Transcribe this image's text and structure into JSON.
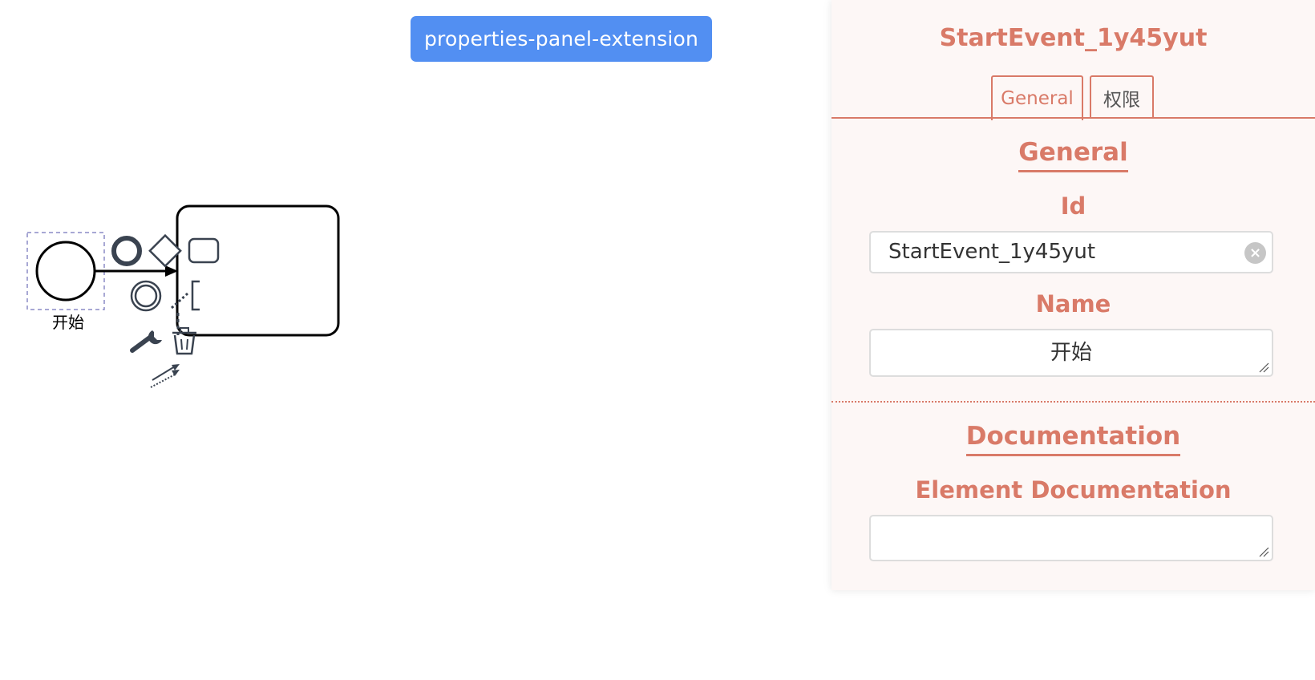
{
  "toolbar": {
    "button_label": "properties-panel-extension"
  },
  "diagram": {
    "start_event_label": "开始"
  },
  "panel": {
    "title": "StartEvent_1y45yut",
    "tabs": [
      {
        "label": "General",
        "active": true
      },
      {
        "label": "权限",
        "active": false
      }
    ],
    "groups": [
      {
        "title": "General",
        "fields": [
          {
            "label": "Id",
            "value": "StartEvent_1y45yut"
          },
          {
            "label": "Name",
            "value": "开始"
          }
        ]
      },
      {
        "title": "Documentation",
        "fields": [
          {
            "label": "Element Documentation",
            "value": ""
          }
        ]
      }
    ]
  },
  "colors": {
    "accent": "#d97a68",
    "button": "#528ff2",
    "panel_bg": "#fdf7f6",
    "icon": "#3a4350"
  },
  "icons": [
    "end-event-icon",
    "gateway-icon",
    "task-icon",
    "intermediate-event-icon",
    "text-annotation-icon",
    "wrench-icon",
    "trash-icon",
    "connect-arrow-icon",
    "clear-icon"
  ]
}
